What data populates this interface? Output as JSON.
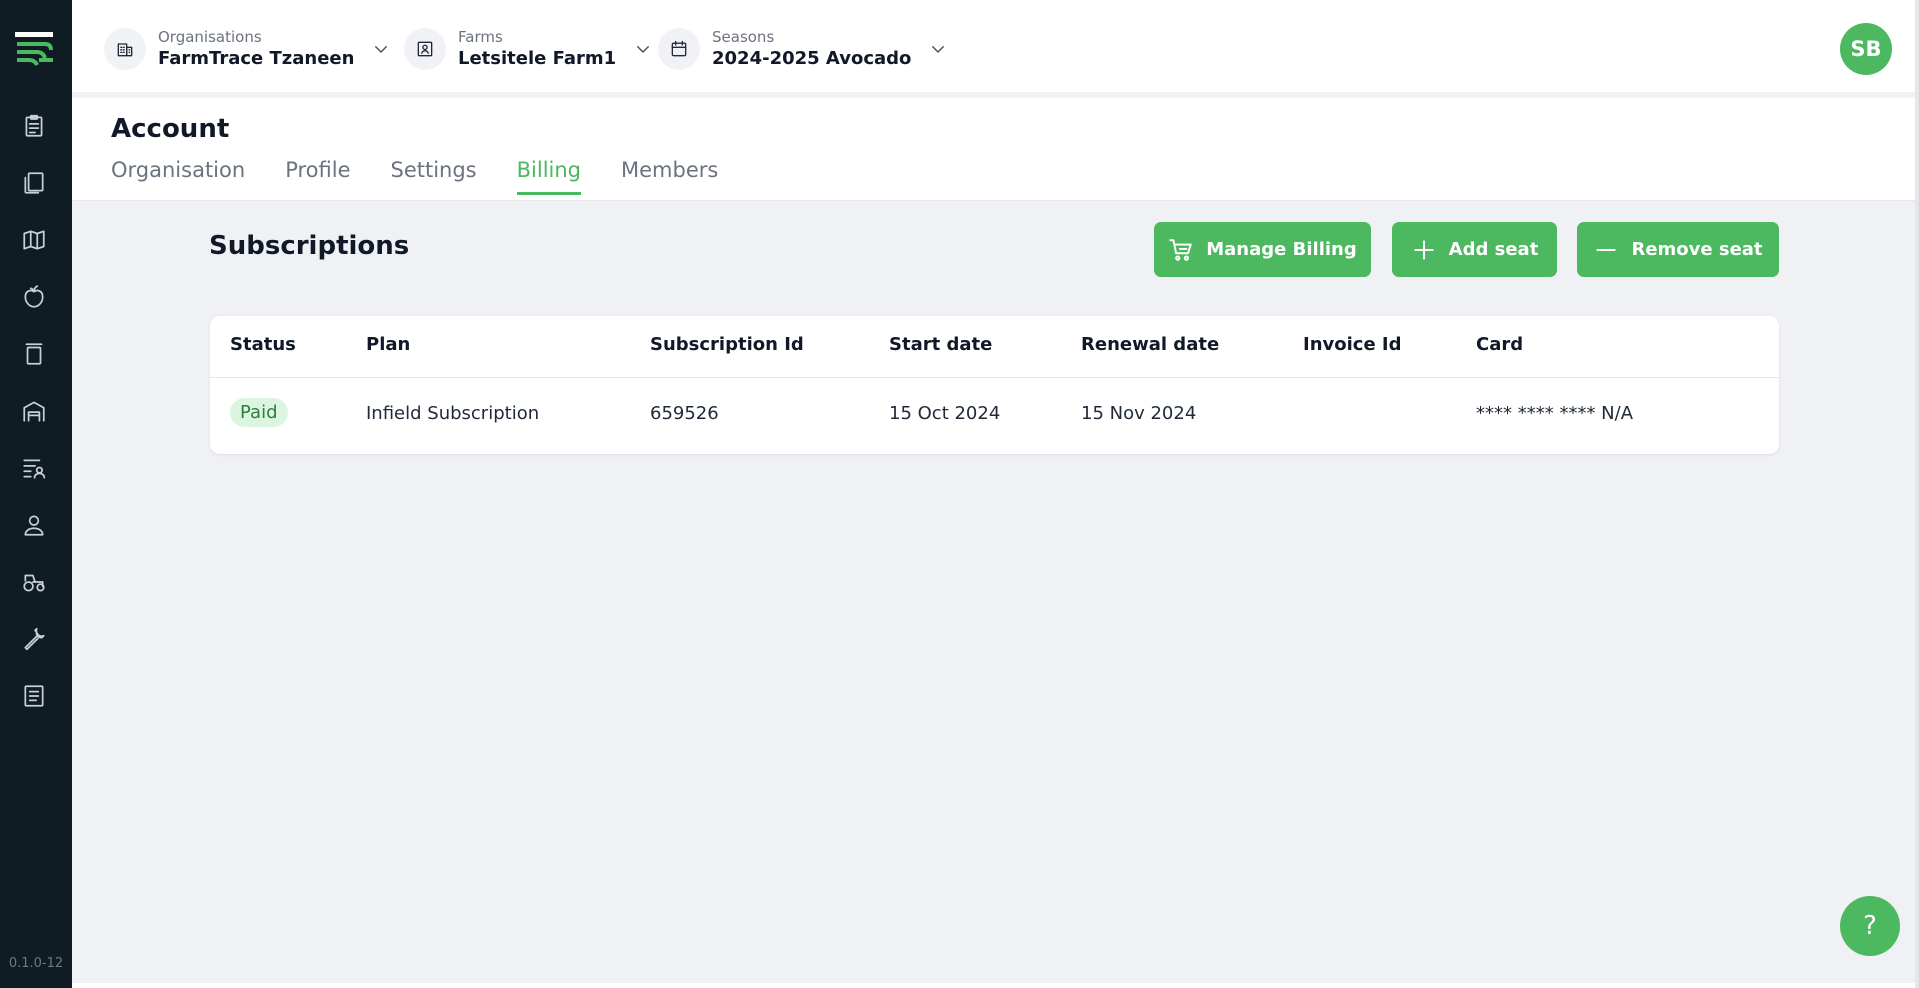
{
  "sidebar": {
    "items": [
      {
        "icon": "clipboard-icon"
      },
      {
        "icon": "pages-icon"
      },
      {
        "icon": "map-icon"
      },
      {
        "icon": "fruit-icon"
      },
      {
        "icon": "container-icon"
      },
      {
        "icon": "warehouse-icon"
      },
      {
        "icon": "tasks-people-icon"
      },
      {
        "icon": "user-icon"
      },
      {
        "icon": "tractor-icon"
      },
      {
        "icon": "wrench-icon"
      },
      {
        "icon": "document-icon"
      }
    ],
    "version": "0.1.0-12"
  },
  "topbar": {
    "organisation": {
      "label": "Organisations",
      "value": "FarmTrace Tzaneen"
    },
    "farm": {
      "label": "Farms",
      "value": "Letsitele Farm1"
    },
    "season": {
      "label": "Seasons",
      "value": "2024-2025 Avocado"
    },
    "avatar": "SB"
  },
  "account": {
    "title": "Account",
    "tabs": [
      "Organisation",
      "Profile",
      "Settings",
      "Billing",
      "Members"
    ],
    "active_tab": "Billing"
  },
  "subscriptions": {
    "title": "Subscriptions",
    "buttons": {
      "manage_billing": "Manage Billing",
      "add_seat": "Add seat",
      "remove_seat": "Remove seat"
    },
    "columns": [
      "Status",
      "Plan",
      "Subscription Id",
      "Start date",
      "Renewal date",
      "Invoice Id",
      "Card"
    ],
    "rows": [
      {
        "status": "Paid",
        "plan": "Infield Subscription",
        "subscription_id": "659526",
        "start_date": "15 Oct 2024",
        "renewal_date": "15 Nov 2024",
        "invoice_id": "",
        "card": "**** **** **** N/A"
      }
    ]
  },
  "help": "?",
  "colors": {
    "accent": "#4cb860",
    "sidebar_bg": "#0f1c23",
    "content_bg": "#f0f1f4",
    "paid_badge_bg": "#dcf5e1"
  }
}
